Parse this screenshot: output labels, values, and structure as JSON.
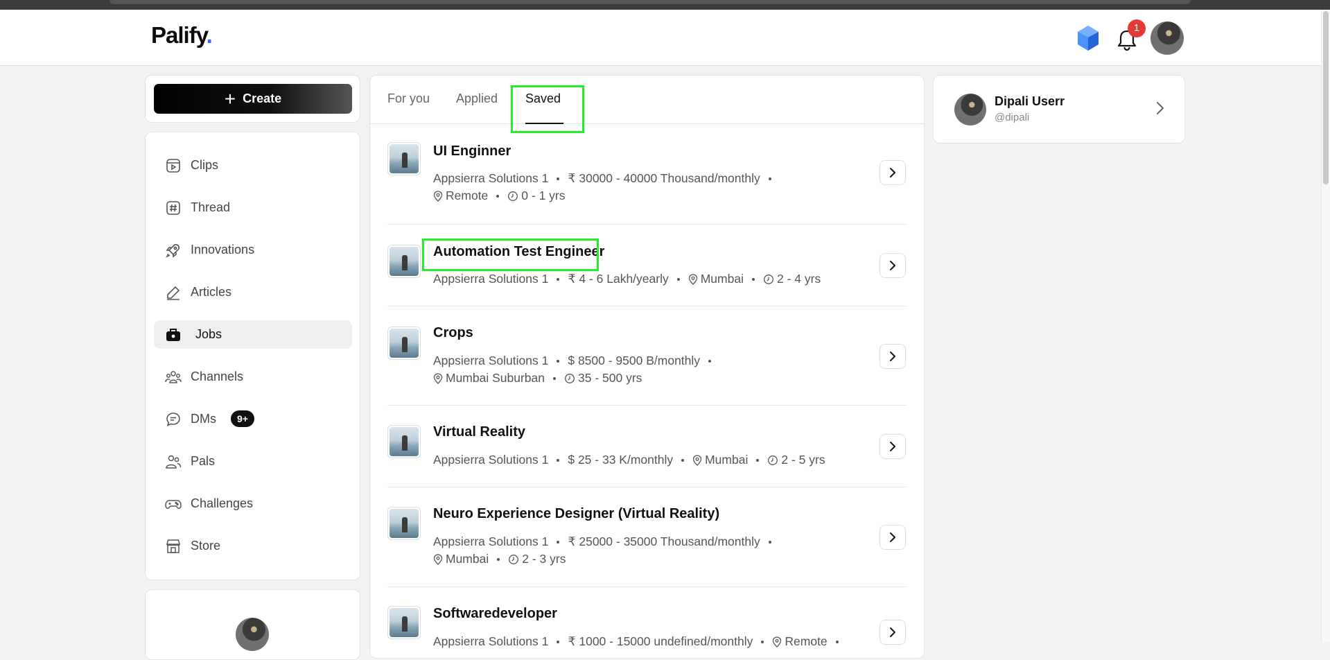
{
  "brand": {
    "name": "Palify",
    "dot": "."
  },
  "header": {
    "notification_count": "1"
  },
  "create": {
    "label": "Create"
  },
  "nav": {
    "items": [
      {
        "key": "clips",
        "label": "Clips",
        "icon": "clips-icon"
      },
      {
        "key": "thread",
        "label": "Thread",
        "icon": "hash-icon"
      },
      {
        "key": "innovations",
        "label": "Innovations",
        "icon": "rocket-icon"
      },
      {
        "key": "articles",
        "label": "Articles",
        "icon": "pencil-icon"
      },
      {
        "key": "jobs",
        "label": "Jobs",
        "icon": "briefcase-icon",
        "active": true
      },
      {
        "key": "channels",
        "label": "Channels",
        "icon": "users-group-icon"
      },
      {
        "key": "dms",
        "label": "DMs",
        "icon": "chat-bubble-icon",
        "badge": "9+"
      },
      {
        "key": "pals",
        "label": "Pals",
        "icon": "pals-icon"
      },
      {
        "key": "challenges",
        "label": "Challenges",
        "icon": "gamepad-icon"
      },
      {
        "key": "store",
        "label": "Store",
        "icon": "store-icon"
      }
    ]
  },
  "tabs": [
    {
      "label": "For you"
    },
    {
      "label": "Applied"
    },
    {
      "label": "Saved",
      "active": true
    }
  ],
  "jobs": [
    {
      "title": "UI Enginner",
      "company": "Appsierra Solutions 1",
      "salary": "₹ 30000 - 40000 Thousand/monthly",
      "location": "Remote",
      "experience": "0 - 1 yrs"
    },
    {
      "title": "Automation Test Engineer",
      "company": "Appsierra Solutions 1",
      "salary": "₹ 4 - 6 Lakh/yearly",
      "location": "Mumbai",
      "experience": "2 - 4 yrs"
    },
    {
      "title": "Crops",
      "company": "Appsierra Solutions 1",
      "salary": "$ 8500 - 9500 B/monthly",
      "location": "Mumbai Suburban",
      "experience": "35 - 500 yrs"
    },
    {
      "title": "Virtual Reality",
      "company": "Appsierra Solutions 1",
      "salary": "$ 25 - 33 K/monthly",
      "location": "Mumbai",
      "experience": "2 - 5 yrs"
    },
    {
      "title": "Neuro Experience Designer (Virtual Reality)",
      "company": "Appsierra Solutions 1",
      "salary": "₹ 25000 - 35000 Thousand/monthly",
      "location": "Mumbai",
      "experience": "2 - 3 yrs"
    },
    {
      "title": "Softwaredeveloper",
      "company": "Appsierra Solutions 1",
      "salary": "₹ 1000 - 15000 undefined/monthly",
      "location": "Remote",
      "experience": ""
    }
  ],
  "profile": {
    "name": "Dipali Userr",
    "handle": "@dipali"
  },
  "colors": {
    "accent": "#2a6df5",
    "badge_red": "#e53935",
    "highlight_green": "#22ee2a"
  }
}
